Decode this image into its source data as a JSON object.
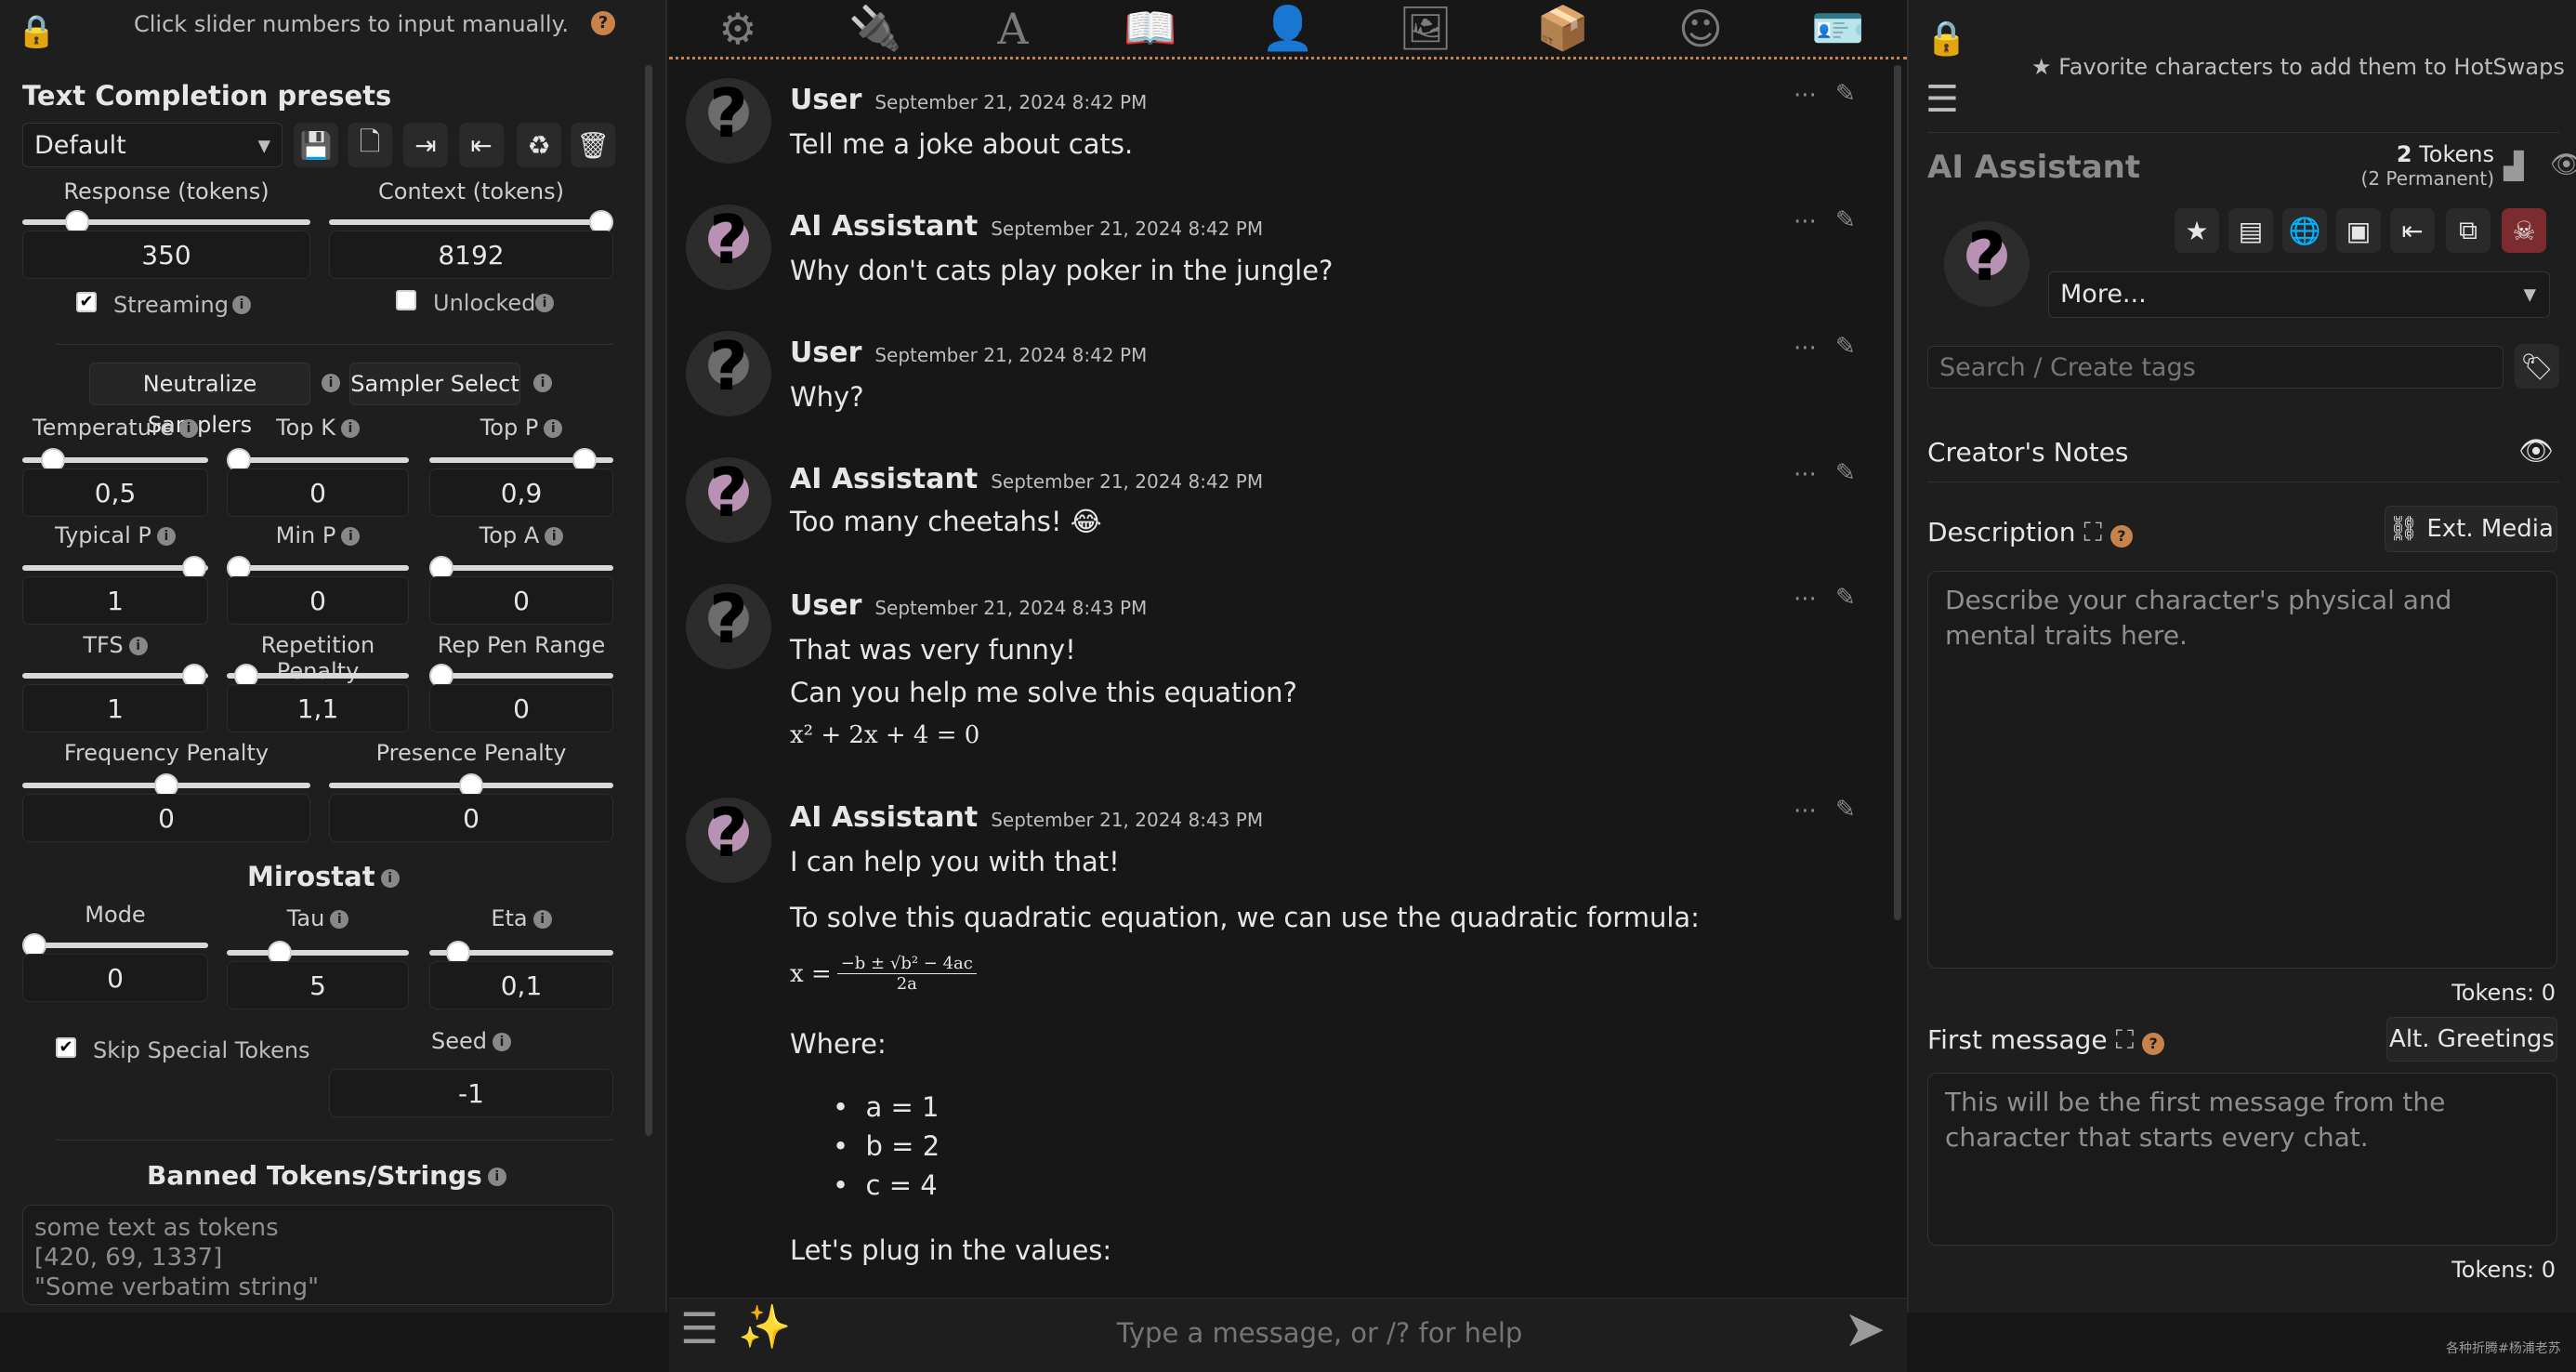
{
  "left_panel": {
    "hint": "Click slider numbers to input manually.",
    "presets_title": "Text Completion presets",
    "preset_value": "Default",
    "response_label": "Response (tokens)",
    "response_value": "350",
    "context_label": "Context (tokens)",
    "context_value": "8192",
    "streaming_label": "Streaming",
    "unlocked_label": "Unlocked",
    "neutralize_label": "Neutralize Samplers",
    "sampler_select_label": "Sampler Select",
    "temperature_label": "Temperature",
    "temperature_value": "0,5",
    "topk_label": "Top K",
    "topk_value": "0",
    "topp_label": "Top P",
    "topp_value": "0,9",
    "typicalp_label": "Typical P",
    "typicalp_value": "1",
    "minp_label": "Min P",
    "minp_value": "0",
    "topa_label": "Top A",
    "topa_value": "0",
    "tfs_label": "TFS",
    "tfs_value": "1",
    "reppen_label": "Repetition Penalty",
    "reppen_value": "1,1",
    "reppenrange_label": "Rep Pen Range",
    "reppenrange_value": "0",
    "freqpen_label": "Frequency Penalty",
    "freqpen_value": "0",
    "prespen_label": "Presence Penalty",
    "prespen_value": "0",
    "mirostat_title": "Mirostat",
    "mode_label": "Mode",
    "mode_value": "0",
    "tau_label": "Tau",
    "tau_value": "5",
    "eta_label": "Eta",
    "eta_value": "0,1",
    "skip_special_label": "Skip Special Tokens",
    "seed_label": "Seed",
    "seed_value": "-1",
    "banned_title": "Banned Tokens/Strings",
    "banned_text_line1": "some text as tokens",
    "banned_text_line2": "[420, 69, 1337]",
    "banned_text_line3": "\"Some verbatim string\""
  },
  "chat": {
    "messages": [
      {
        "name": "User",
        "time": "September 21, 2024 8:42 PM",
        "text": "Tell me a joke about cats."
      },
      {
        "name": "AI Assistant",
        "time": "September 21, 2024 8:42 PM",
        "text": "Why don't cats play poker in the jungle?"
      },
      {
        "name": "User",
        "time": "September 21, 2024 8:42 PM",
        "text": "Why?"
      },
      {
        "name": "AI Assistant",
        "time": "September 21, 2024 8:42 PM",
        "text": "Too many cheetahs! 😂"
      },
      {
        "name": "User",
        "time": "September 21, 2024 8:43 PM",
        "line1": "That was very funny!",
        "line2": "Can you help me solve this equation?",
        "equation": "x² + 2x + 4 = 0"
      },
      {
        "name": "AI Assistant",
        "time": "September 21, 2024 8:43 PM",
        "line1": "I can help you with that!",
        "line2": "To solve this quadratic equation, we can use the quadratic formula:",
        "formula_lhs": "x =",
        "formula_num": "−b ± √b² − 4ac",
        "formula_den": "2a",
        "where": "Where:",
        "bullet_a": "a = 1",
        "bullet_b": "b = 2",
        "bullet_c": "c = 4",
        "plug": "Let's plug in the values:"
      }
    ],
    "input_placeholder": "Type a message, or /? for help"
  },
  "right_panel": {
    "hotswaps_hint": "Favorite characters to add them to HotSwaps",
    "char_name": "AI Assistant",
    "tokens_count": "2",
    "tokens_label": "Tokens",
    "tokens_permanent": "(2 Permanent)",
    "more_label": "More...",
    "tags_placeholder": "Search / Create tags",
    "creators_notes": "Creator's Notes",
    "description_label": "Description",
    "ext_media_label": "Ext. Media",
    "description_placeholder": "Describe your character's physical and mental traits here.",
    "desc_tokens": "Tokens: 0",
    "first_message_label": "First message",
    "alt_greetings_label": "Alt. Greetings",
    "first_message_placeholder": "This will be the first message from the character that starts every chat.",
    "first_tokens": "Tokens: 0"
  },
  "watermark": "各种折腾#杨浦老苏"
}
